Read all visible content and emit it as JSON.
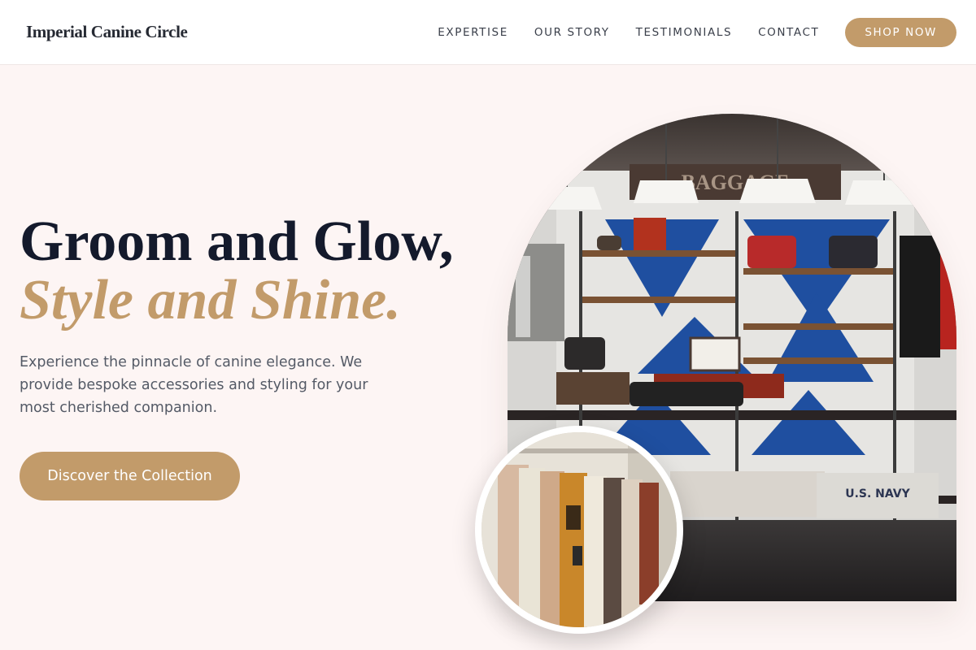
{
  "nav": {
    "brand": "Imperial Canine Circle",
    "links": [
      "EXPERTISE",
      "OUR STORY",
      "TESTIMONIALS",
      "CONTACT"
    ],
    "shop_label": "SHOP NOW"
  },
  "hero": {
    "title_line1": "Groom and Glow,",
    "title_line2": "Style and Shine.",
    "description": "Experience the pinnacle of canine elegance. We provide bespoke accessories and styling for your most cherished companion.",
    "cta_label": "Discover the Collection"
  },
  "images": {
    "store_banner_text": "BAGGAGE",
    "shirt_label": "U.S. NAVY"
  },
  "colors": {
    "accent": "#c29b6a",
    "background": "#fdf5f4",
    "heading": "#141a2c"
  }
}
